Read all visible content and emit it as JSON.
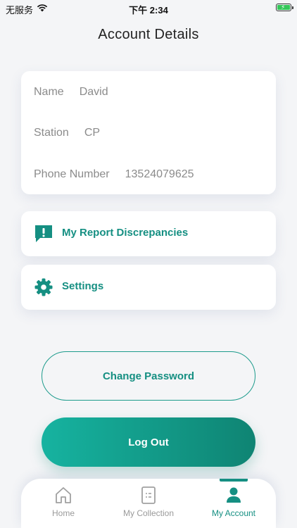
{
  "status_bar": {
    "carrier": "无服务",
    "time": "下午 2:34"
  },
  "page": {
    "title": "Account Details"
  },
  "account": {
    "rows": [
      {
        "label": "Name",
        "value": "David"
      },
      {
        "label": "Station",
        "value": "CP"
      },
      {
        "label": "Phone Number",
        "value": "13524079625"
      }
    ]
  },
  "menu": {
    "report_label": "My Report Discrepancies",
    "settings_label": "Settings"
  },
  "buttons": {
    "change_password": "Change Password",
    "log_out": "Log Out"
  },
  "tabs": [
    {
      "label": "Home",
      "icon": "home-icon"
    },
    {
      "label": "My Collection",
      "icon": "list-icon"
    },
    {
      "label": "My Account",
      "icon": "user-icon",
      "active": true
    }
  ],
  "colors": {
    "accent": "#158f82",
    "gradient_start": "#16b3a0",
    "gradient_end": "#0f8473",
    "background": "#f4f5f7"
  }
}
